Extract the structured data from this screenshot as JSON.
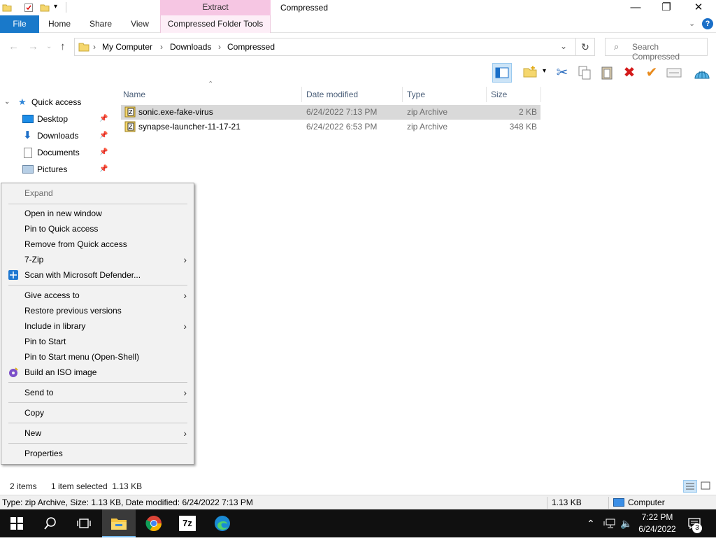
{
  "window": {
    "title": "Compressed",
    "contextual_tab_header": "Extract",
    "controls": {
      "minimize": "—",
      "maximize": "❐",
      "close": "✕"
    }
  },
  "ribbon": {
    "tabs": [
      "File",
      "Home",
      "Share",
      "View",
      "Compressed Folder Tools"
    ]
  },
  "address": {
    "breadcrumb": [
      "My Computer",
      "Downloads",
      "Compressed"
    ],
    "search_placeholder": "Search Compressed"
  },
  "nav": {
    "quick_access_label": "Quick access",
    "items": [
      {
        "label": "Desktop",
        "icon": "desktop-icon",
        "pinned": true
      },
      {
        "label": "Downloads",
        "icon": "download-icon",
        "pinned": true
      },
      {
        "label": "Documents",
        "icon": "document-icon",
        "pinned": true
      },
      {
        "label": "Pictures",
        "icon": "pictures-icon",
        "pinned": true
      }
    ]
  },
  "file_list": {
    "columns": [
      "Name",
      "Date modified",
      "Type",
      "Size"
    ],
    "rows": [
      {
        "name": "sonic.exe-fake-virus",
        "date": "6/24/2022 7:13 PM",
        "type": "zip Archive",
        "size": "2 KB",
        "selected": true
      },
      {
        "name": "synapse-launcher-11-17-21",
        "date": "6/24/2022 6:53 PM",
        "type": "zip Archive",
        "size": "348 KB",
        "selected": false
      }
    ]
  },
  "context_menu": {
    "items": [
      {
        "label": "Expand",
        "disabled": true
      },
      {
        "label": "Open in new window"
      },
      {
        "label": "Pin to Quick access"
      },
      {
        "label": "Remove from Quick access"
      },
      {
        "label": "7-Zip",
        "submenu": true
      },
      {
        "label": "Scan with Microsoft Defender...",
        "icon": "defender-icon"
      },
      {
        "label": "Give access to",
        "submenu": true
      },
      {
        "label": "Restore previous versions"
      },
      {
        "label": "Include in library",
        "submenu": true
      },
      {
        "label": "Pin to Start"
      },
      {
        "label": "Pin to Start menu (Open-Shell)"
      },
      {
        "label": "Build an ISO image",
        "icon": "iso-icon"
      },
      {
        "label": "Send to",
        "submenu": true
      },
      {
        "label": "Copy"
      },
      {
        "label": "New",
        "submenu": true
      },
      {
        "label": "Properties"
      }
    ]
  },
  "status": {
    "item_count": "2 items",
    "selection": "1 item selected  1.13 KB"
  },
  "details_bar": {
    "info": "Type: zip Archive, Size: 1.13 KB, Date modified: 6/24/2022 7:13 PM",
    "size": "1.13 KB",
    "location": "Computer"
  },
  "taskbar": {
    "apps": [
      "start-icon",
      "search-icon",
      "task-view-icon",
      "file-explorer-icon",
      "chrome-icon",
      "7zip-icon",
      "edge-icon"
    ],
    "seven_zip_label": "7z",
    "time": "7:22 PM",
    "date": "6/24/2022",
    "notification_count": "3"
  },
  "colors": {
    "accent": "#1979ca",
    "contextual_tab": "#f6c6e3",
    "selection": "#d9d9d9",
    "menu_bg": "#f2f2f2",
    "taskbar": "#101010"
  }
}
